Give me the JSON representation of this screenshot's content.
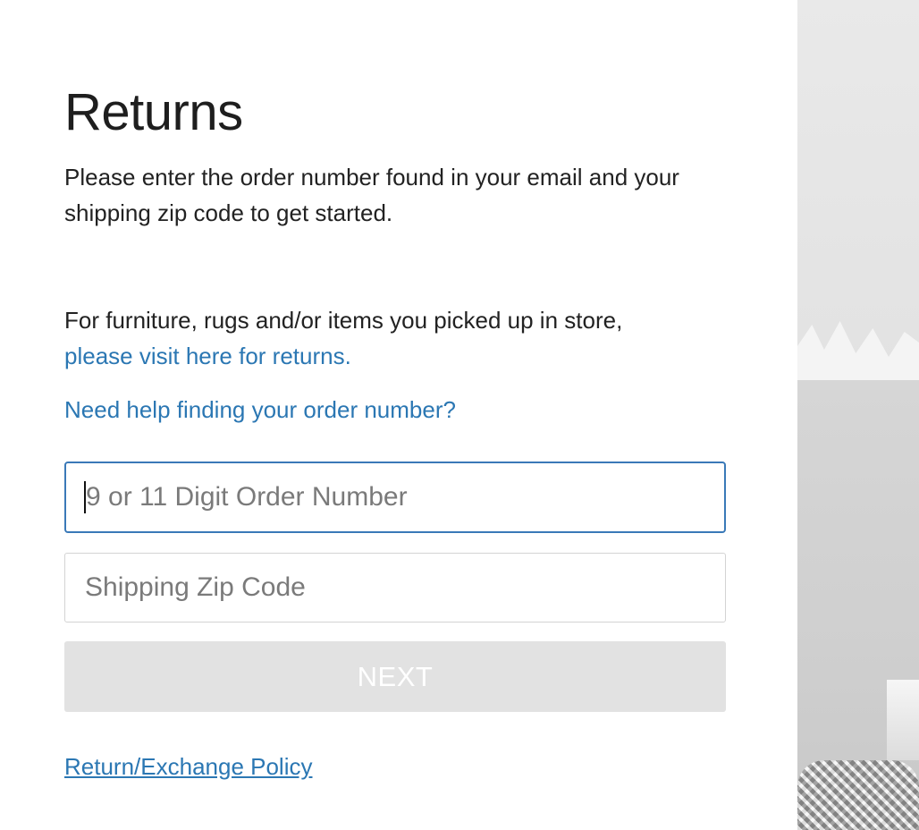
{
  "page": {
    "title": "Returns",
    "intro_text": "Please enter the order number found in your email and your shipping zip code to get started."
  },
  "store_note": {
    "text": "For furniture, rugs and/or items you picked up in store,",
    "link_label": "please visit here for returns."
  },
  "help_link": {
    "label": "Need help finding your order number?"
  },
  "form": {
    "order_number": {
      "value": "",
      "placeholder": "9 or 11 Digit Order Number"
    },
    "zip_code": {
      "value": "",
      "placeholder": "Shipping Zip Code"
    },
    "next_label": "NEXT"
  },
  "footer": {
    "policy_link": "Return/Exchange Policy"
  },
  "colors": {
    "link": "#2b77b3",
    "focus_border": "#3a79b8",
    "disabled_button": "#e2e2e2"
  }
}
